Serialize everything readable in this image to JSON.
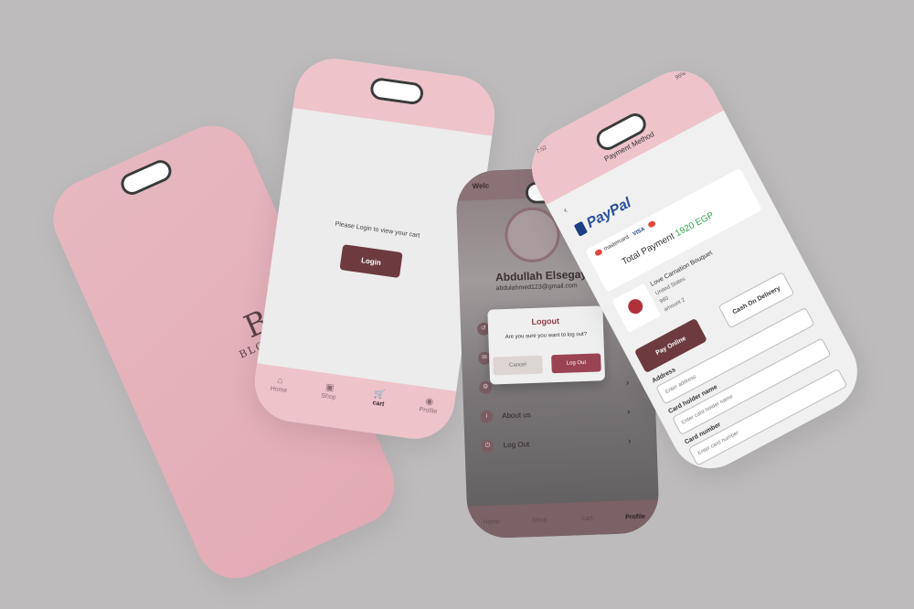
{
  "splash": {
    "logo_monogram": "B",
    "logo_text": "BLOOMI"
  },
  "cart_screen": {
    "message": "Please Login to view your cart",
    "login_label": "Login",
    "nav": [
      {
        "icon": "home-icon",
        "glyph": "⌂",
        "label": "Home"
      },
      {
        "icon": "shop-icon",
        "glyph": "▣",
        "label": "Shop"
      },
      {
        "icon": "cart-icon",
        "glyph": "🛒",
        "label": "cart"
      },
      {
        "icon": "profile-icon",
        "glyph": "◉",
        "label": "Profile"
      }
    ]
  },
  "profile_screen": {
    "welcome": "Welc",
    "name": "Abdullah Elsegay",
    "email": "abdulahmed123@gmail.com",
    "menu": [
      {
        "icon": "history-icon",
        "glyph": "↺",
        "label": ""
      },
      {
        "icon": "mail-icon",
        "glyph": "✉",
        "label": ""
      },
      {
        "icon": "settings-icon",
        "glyph": "⚙",
        "label": ""
      },
      {
        "icon": "info-icon",
        "glyph": "i",
        "label": "About us"
      },
      {
        "icon": "logout-icon",
        "glyph": "⏻",
        "label": "Log Out"
      }
    ],
    "nav": [
      {
        "label": "Home"
      },
      {
        "label": "Shop"
      },
      {
        "label": "cart"
      },
      {
        "label": "Profile"
      }
    ],
    "dialog": {
      "title": "Logout",
      "message": "Are you sure you want to log out?",
      "cancel_label": "Cancel",
      "confirm_label": "Log Out"
    }
  },
  "payment_screen": {
    "status_time": "7:52",
    "status_battery": "95%",
    "title": "Payment Method",
    "provider": "PayPal",
    "cards_label": "mastercard",
    "visa_label": "VISA",
    "total_label": "Total Payment",
    "total_amount": "1920 EGP",
    "product": {
      "name": "Love Carnation Bouquet",
      "country": "United States",
      "price": "960",
      "amount": "amount 2"
    },
    "pay_online_label": "Pay Online",
    "cod_label": "Cash On Delivery",
    "address_label": "Address",
    "address_placeholder": "Enter address",
    "holder_label": "Card holder name",
    "holder_placeholder": "Enter card holder name",
    "card_number_label": "Card number",
    "card_number_placeholder": "Enter card number"
  },
  "colors": {
    "background": "#bdbbbc",
    "pink": "#eec3ca",
    "maroon": "#6d3a3f",
    "accent_green": "#2ea84d"
  }
}
